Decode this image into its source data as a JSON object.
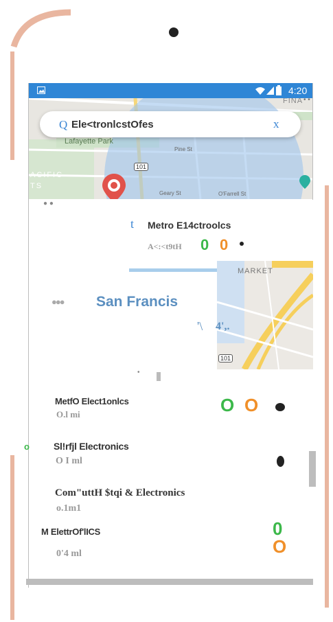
{
  "status": {
    "time": "4:20"
  },
  "search": {
    "icon_glyph": "Q",
    "query": "Ele<tronlcstOfes",
    "clear_glyph": "x"
  },
  "map_labels": {
    "park": "Lafayette Park",
    "ocean": "ACIFIC",
    "ocean2": "TS",
    "highway": "101",
    "street1": "Pine St",
    "street2": "Geary St",
    "street3": "O'Farrell St",
    "corner": "FINA",
    "market": "MARKET",
    "highway2": "101"
  },
  "selected": {
    "icon_glyph": "t",
    "name": "Metro E14ctroolcs",
    "address": "A<:<t9tH",
    "badge1": "0",
    "badge2": "0"
  },
  "city": {
    "dots": "●●●",
    "name": "San  Francis",
    "sub1": "'\\",
    "sub2": "4',."
  },
  "results": [
    {
      "name": "MetfO Elect1onlcs",
      "distance": "O.l mi",
      "badge1": "O",
      "badge2": "O"
    },
    {
      "prefix": "o",
      "name": "Sl!rfjl Electronics",
      "distance": "O I ml"
    },
    {
      "name": "Com\"uttH $tqi & Electronics",
      "distance": "o.1m1"
    },
    {
      "name": "M ElettrOf'lICS",
      "distance": "0'4 ml",
      "badge1": "0",
      "badge2": "O"
    }
  ],
  "colors": {
    "accent": "#2f86d6",
    "green": "#3cb84a",
    "orange": "#f0902a",
    "city_text": "#5b8fc0"
  }
}
